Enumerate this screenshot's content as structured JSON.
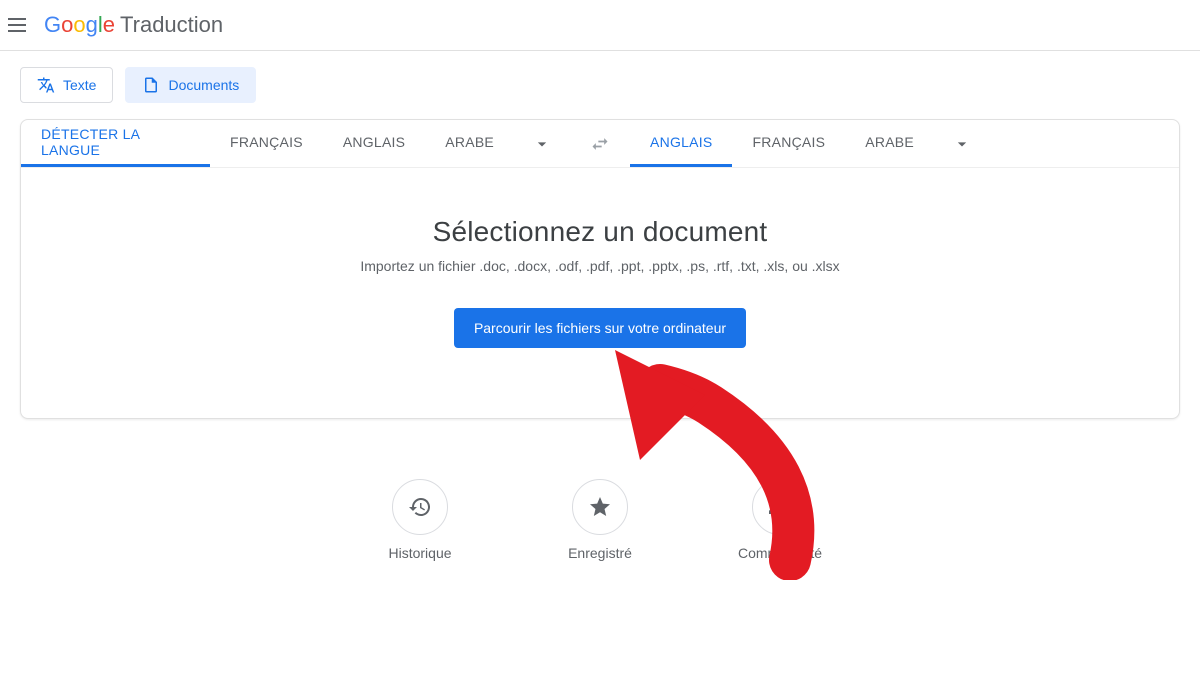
{
  "header": {
    "logo_prefix": "Google",
    "product_name": "Traduction"
  },
  "tabs": {
    "text_label": "Texte",
    "documents_label": "Documents"
  },
  "source_languages": {
    "detect": "DÉTECTER LA LANGUE",
    "lang1": "FRANÇAIS",
    "lang2": "ANGLAIS",
    "lang3": "ARABE",
    "active": "detect"
  },
  "target_languages": {
    "lang1": "ANGLAIS",
    "lang2": "FRANÇAIS",
    "lang3": "ARABE",
    "active": "lang1"
  },
  "document_panel": {
    "title": "Sélectionnez un document",
    "subtitle": "Importez un fichier .doc, .docx, .odf, .pdf, .ppt, .pptx, .ps, .rtf, .txt, .xls, ou .xlsx",
    "browse_button": "Parcourir les fichiers sur votre ordinateur"
  },
  "footer": {
    "history": "Historique",
    "saved": "Enregistré",
    "community": "Communauté"
  }
}
